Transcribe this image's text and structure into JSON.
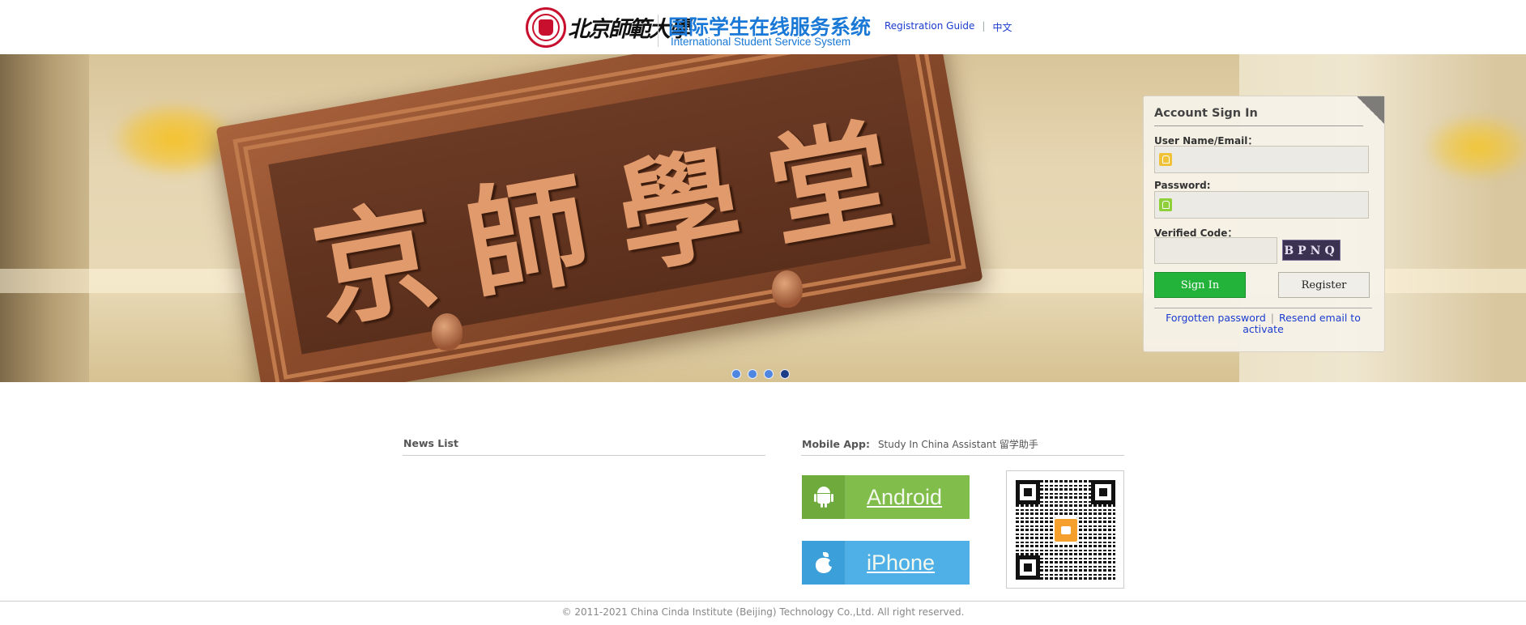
{
  "header": {
    "logo_university": "北京師範大學",
    "system_title_cn": "国际学生在线服务系统",
    "system_title_en": "International Student Service System",
    "nav": {
      "registration_guide": "Registration Guide",
      "separator": "|",
      "language": "中文"
    }
  },
  "banner": {
    "plaque_chars": [
      "京",
      "師",
      "學",
      "堂"
    ],
    "slides_total": 4,
    "active_slide": 4
  },
  "login": {
    "title": "Account Sign In",
    "username_label": "User Name/Email：",
    "username_value": "",
    "password_label": "Password:",
    "password_value": "",
    "code_label": "Verified Code：",
    "code_value": "",
    "captcha_text": "BPNQ",
    "signin_label": "Sign In",
    "register_label": "Register",
    "forgot_label": "Forgotten password",
    "links_separator": "|",
    "resend_label": "Resend email to activate"
  },
  "news": {
    "title": "News List",
    "items": []
  },
  "mobile": {
    "title": "Mobile App:",
    "subtitle": "Study In China Assistant  留学助手",
    "android_label": "Android",
    "iphone_label": "iPhone"
  },
  "footer": {
    "copyright": "© 2011-2021 China Cinda Institute (Beijing) Technology Co.,Ltd. All right reserved."
  },
  "colors": {
    "brand_blue": "#1a78d6",
    "signin_green": "#23b33b",
    "android_green": "#80bd4a",
    "iphone_blue": "#4fb0e8",
    "link_blue": "#1a3ccf",
    "seal_red": "#c8102e"
  }
}
